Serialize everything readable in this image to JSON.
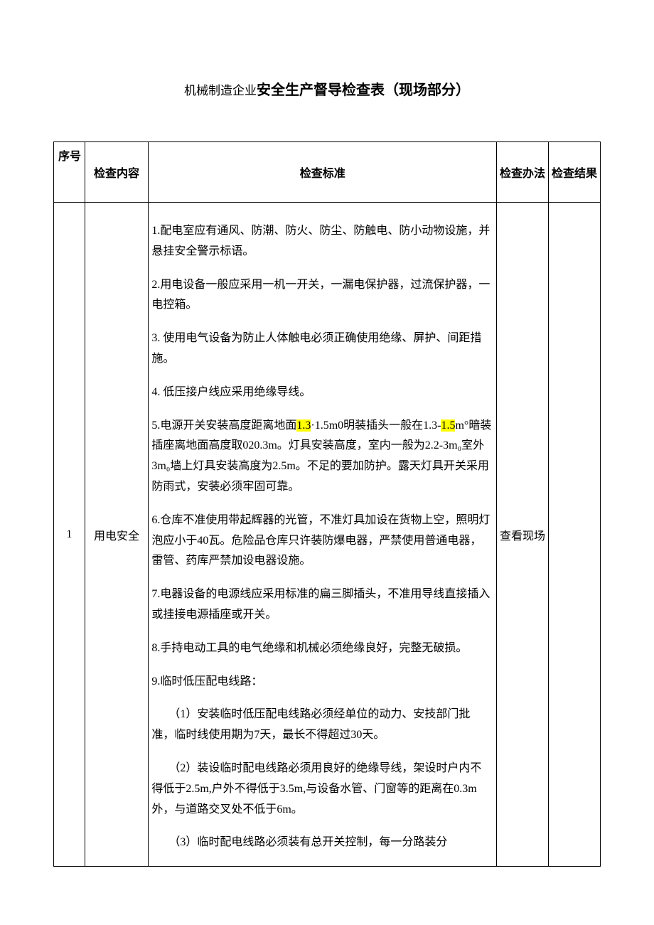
{
  "title": {
    "prefix": "机械制造企业",
    "main": "安全生产督导检查表（现场部分）"
  },
  "headers": {
    "seq": "序号",
    "item": "检查内容",
    "std": "检查标准",
    "method": "检查办法",
    "result": "检查结果"
  },
  "rows": [
    {
      "seq": "1",
      "item": "用电安全",
      "method": "查看现场",
      "result": "",
      "std_blocks": [
        {
          "t": "1.配电室应有通风、防潮、防火、防尘、防触电、防小动物设施，并悬挂安全警示标语。"
        },
        {
          "t": "2.用电设备一般应采用一机一开关，一漏电保护器，过流保护器，一电控箱。"
        },
        {
          "t": "3. 使用电气设备为防止人体触电必须正确使用绝缘、屏护、间距措施。"
        },
        {
          "t": "4. 低压接户线应采用绝缘导线。"
        },
        {
          "seg": [
            {
              "t": "5.电源开关安装高度距离地面"
            },
            {
              "t": "1.3",
              "hl": true
            },
            {
              "t": "·1.5m0明装插头一般在1.3-"
            },
            {
              "t": "1.5",
              "hl": true
            },
            {
              "t": "m°暗装插座离地面高度取020.3m。灯具安装高度，室内一般为2.2-3m₀室外3m₀墙上灯具安装高度为2.5m。不足的要加防护。露天灯具开关采用防雨式，安装必须牢固可靠。"
            }
          ]
        },
        {
          "t": "6.仓库不准使用带起辉器的光管，不准灯具加设在货物上空，照明灯泡应小于40瓦。危险品仓库只许装防爆电器，严禁使用普通电器，雷管、药库严禁加设电器设施。"
        },
        {
          "t": "7.电器设备的电源线应采用标准的扁三脚插头，不准用导线直接插入或挂接电源插座或开关。"
        },
        {
          "t": "8.手持电动工具的电气绝缘和机械必须绝缘良好，完整无破损。"
        },
        {
          "t": "9.临时低压配电线路："
        },
        {
          "t": "（1）安装临时低压配电线路必须经单位的动力、安技部门批准，临时线使用期为7天，最长不得超过30天。",
          "sub": true
        },
        {
          "t": "（2）装设临时配电线路必须用良好的绝缘导线，架设时户内不得低于2.5m,户外不得低于3.5m,与设备水管、门窗等的距离在0.3m外，与道路交叉处不低于6m。",
          "sub": true
        },
        {
          "t": "（3）临时配电线路必须装有总开关控制，每一分路装分",
          "sub": true
        }
      ]
    }
  ]
}
